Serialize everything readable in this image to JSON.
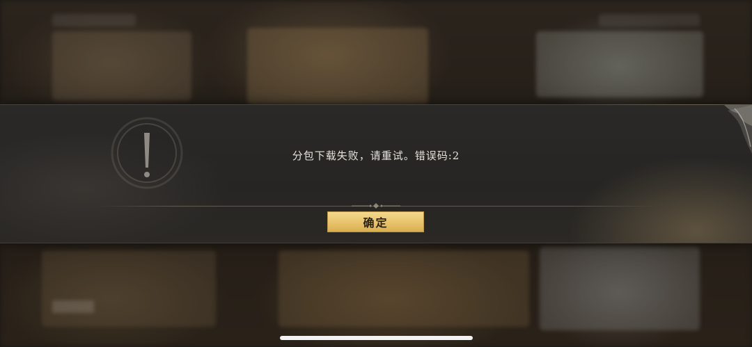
{
  "dialog": {
    "message": "分包下载失败，请重试。错误码:2",
    "confirm_label": "确定"
  },
  "icons": {
    "warning": "exclamation-warning-icon",
    "corner": "ornament-corner-icon"
  },
  "colors": {
    "button_gold": "#e8c36b",
    "button_text": "#2b2214",
    "message_text": "#e6e2da"
  }
}
